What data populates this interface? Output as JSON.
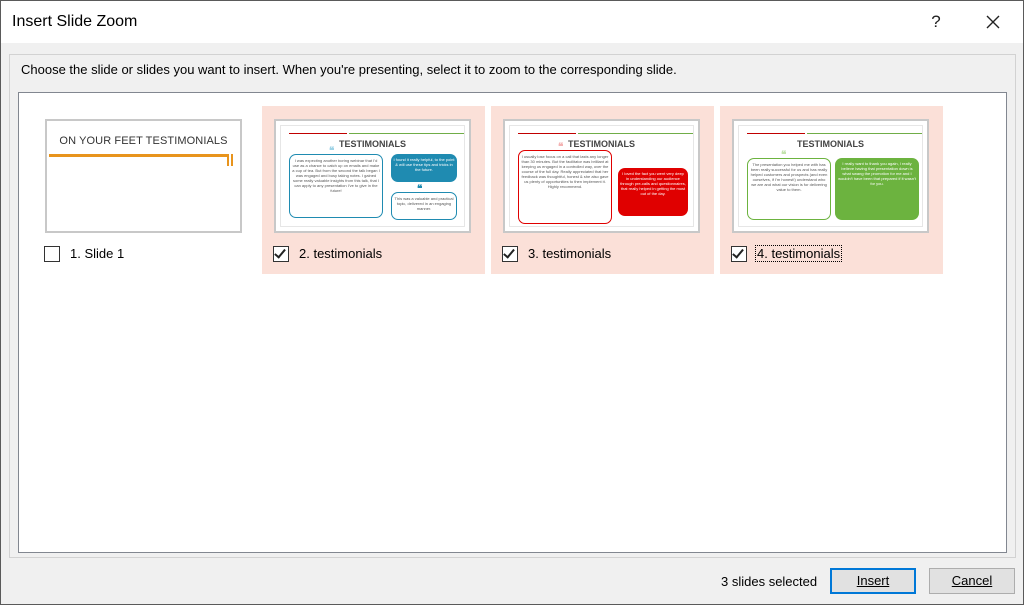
{
  "dialog": {
    "title": "Insert Slide Zoom",
    "help_label": "?",
    "close_label": "✕",
    "prompt": "Choose the slide or slides you want to insert. When you're presenting, select it to zoom to the corresponding slide."
  },
  "slides": [
    {
      "label": "1. Slide 1",
      "checked": false,
      "thumb_title": "ON YOUR FEET TESTIMONIALS"
    },
    {
      "label": "2. testimonials",
      "checked": true,
      "thumb_title": "TESTIMONIALS",
      "bubble_a": "I was expecting another boring webinar that I'd use as a chance to catch up on emails and make a cup of tea. But from the second the talk began I was engaged and busy taking notes. I gained some really valuable insights from this talk, that I can apply to any presentation I've to give in the future!",
      "bubble_b": "I found it really helpful, to the point & will use these tips and tricks in the future.",
      "bubble_c": "This was a valuable and practical topic, delivered in an engaging manner."
    },
    {
      "label": "3. testimonials",
      "checked": true,
      "thumb_title": "TESTIMONIALS",
      "bubble_a": "I usually lose focus on a call that lasts any longer than 30 minutes. But the facilitator was brilliant at keeping us engaged in a controlled way, over the course of the full day. Really appreciated that her feedback was thoughtful, honest & she also gave us plenty of opportunities to then implement it. Highly recommend.",
      "bubble_b": "I loved the fact you went very deep in understanding our audience through pre-calls and questionnaires, that really helped in getting the most out of the day."
    },
    {
      "label": "4. testimonials",
      "checked": true,
      "focused": true,
      "thumb_title": "TESTIMONIALS",
      "bubble_a": "The presentation you helped me with has been really successful for us and has really helped customers and prospects (and even ourselves, if I'm honest!) understand who we are and what our vision is for delivering value to them.",
      "bubble_b": "I really want to thank you again, I really believe having that presentation down is what swang the promotion for me and I wouldn't have been that prepared if it wasn't for you."
    }
  ],
  "footer": {
    "status": "3 slides selected",
    "insert_label": "Insert",
    "cancel_label": "Cancel"
  },
  "colors": {
    "selected_bg": "#fbe0d8",
    "accent_orange": "#e8941c",
    "teal": "#1f8bb1",
    "red": "#e00000",
    "green": "#6cb33f",
    "focus_blue": "#0078d7"
  }
}
